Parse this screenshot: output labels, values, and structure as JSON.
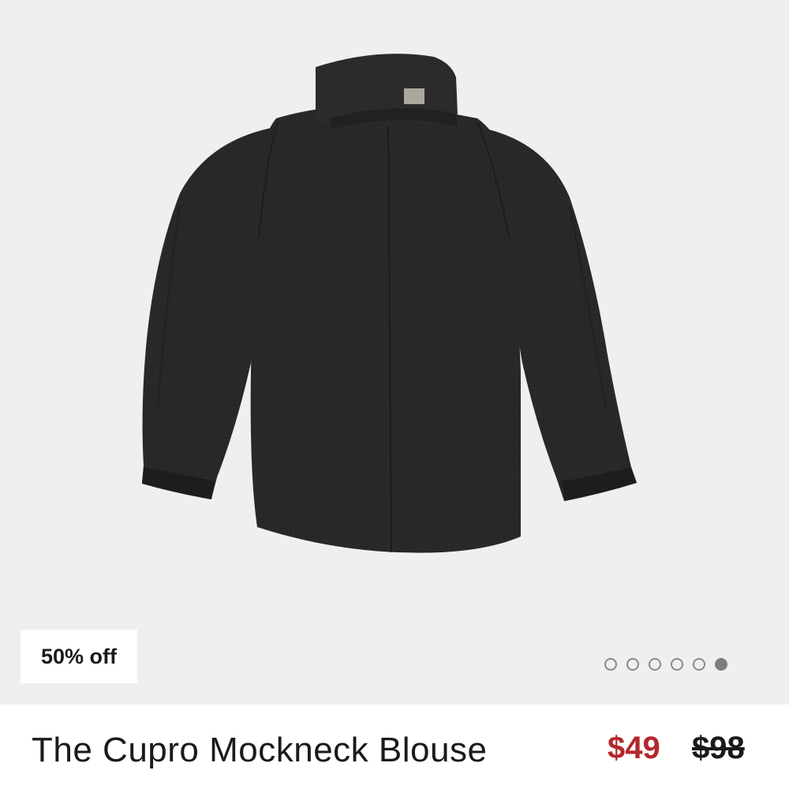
{
  "product": {
    "name": "The Cupro Mockneck Blouse",
    "badge": "50% off",
    "price_sale": "$49",
    "price_original": "$98",
    "image_alt": "Black cupro mockneck blouse"
  },
  "carousel": {
    "total": 6,
    "active_index": 6
  },
  "colors": {
    "image_background": "#efefef",
    "garment": "#2a2828",
    "sale_price": "#b3272d",
    "text": "#1a1a1a"
  }
}
